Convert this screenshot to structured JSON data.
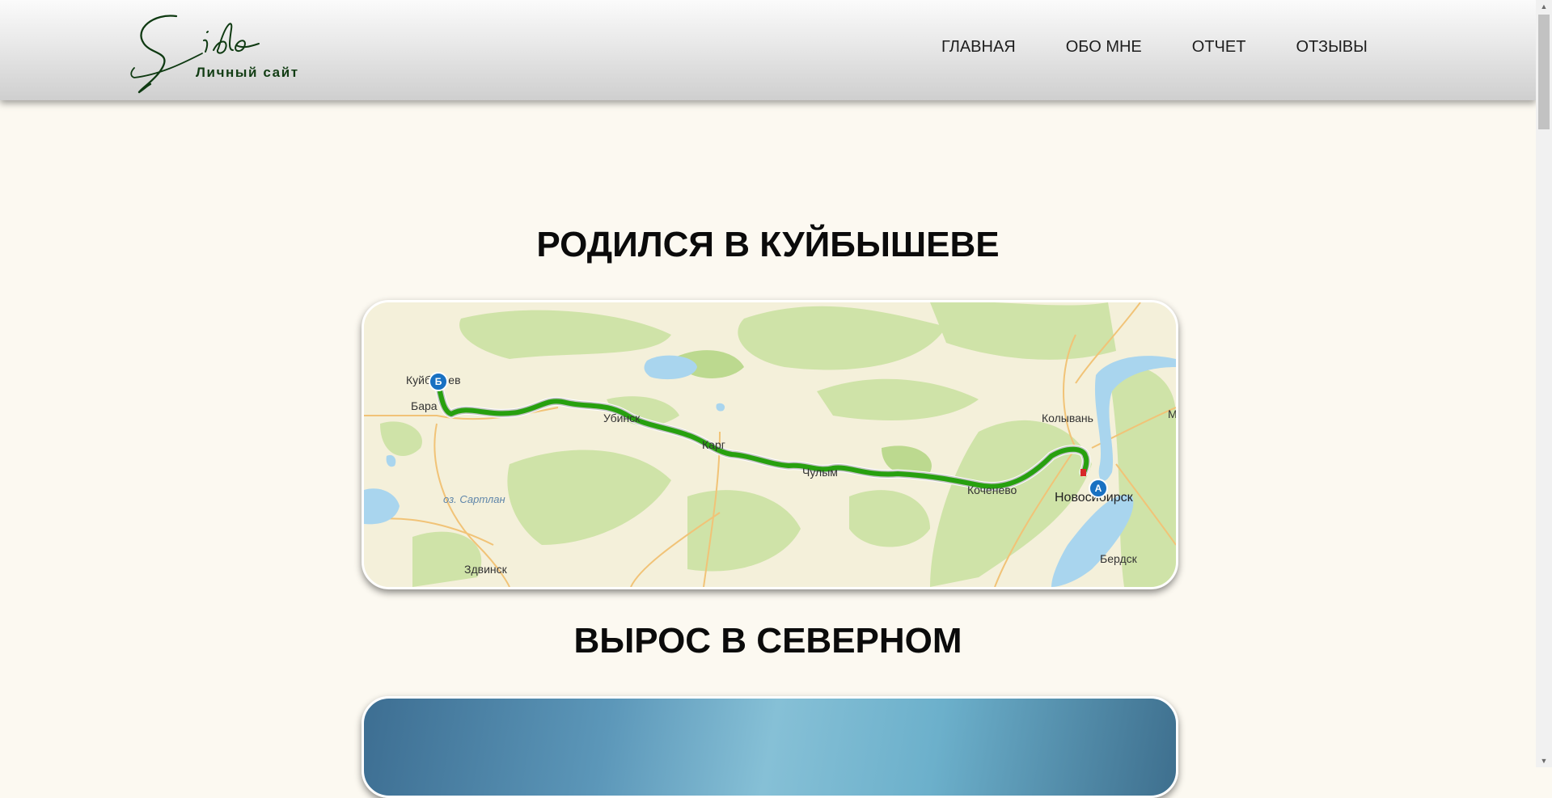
{
  "header": {
    "logo_script": "Sido",
    "logo_tagline": "Личный сайт",
    "nav": [
      {
        "label": "ГЛАВНАЯ"
      },
      {
        "label": "ОБО МНЕ"
      },
      {
        "label": "ОТЧЕТ"
      },
      {
        "label": "ОТЗЫВЫ"
      }
    ]
  },
  "sections": [
    {
      "title": "РОДИЛСЯ В КУЙБЫШЕВЕ"
    },
    {
      "title": "ВЫРОС В СЕВЕРНОМ"
    }
  ],
  "map": {
    "route_color": "#27a00f",
    "pins": {
      "start": "А",
      "end": "Б"
    },
    "labels": {
      "kuybyshev": "Куйбышев",
      "barabinsk": "Бара",
      "ubinskoe": "Убинск",
      "kargat": "Карг",
      "chulym": "Чулым",
      "kochenevo": "Коченево",
      "kolyvan": "Колывань",
      "novosibirsk": "Новосибирск",
      "berdsk": "Бердск",
      "zdvinsk": "Здвинск",
      "sartlan": "оз. Сартлан",
      "edge_m": "М"
    }
  }
}
